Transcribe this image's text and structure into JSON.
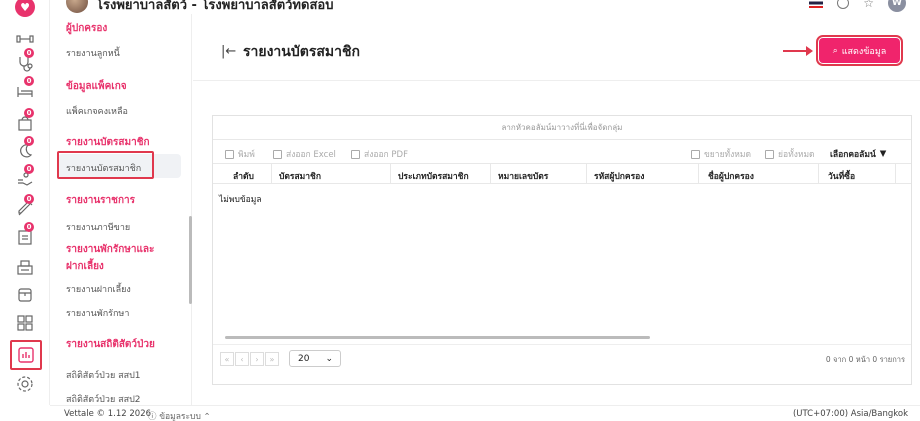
{
  "header": {
    "title": "โรงพยาบาลสัตว์ - โรงพยาบาลสัตว์ทดสอบ",
    "user_initial": "W"
  },
  "submenu": {
    "items": [
      {
        "type": "heading",
        "label": "ผู้ปกครอง"
      },
      {
        "type": "link",
        "label": "รายงานลูกหนี้"
      },
      {
        "type": "heading",
        "label": "ข้อมูลแพ็คเกจ"
      },
      {
        "type": "link",
        "label": "แพ็คเกจคงเหลือ"
      },
      {
        "type": "heading",
        "label": "รายงานบัตรสมาชิก"
      },
      {
        "type": "link",
        "label": "รายงานบัตรสมาชิก",
        "active": true
      },
      {
        "type": "heading",
        "label": "รายงานราชการ"
      },
      {
        "type": "link",
        "label": "รายงานภาษีขาย"
      },
      {
        "type": "heading",
        "label": "รายงานพักรักษาและ"
      },
      {
        "type": "heading",
        "label": "ฝากเลี้ยง"
      },
      {
        "type": "link",
        "label": "รายงานฝากเลี้ยง"
      },
      {
        "type": "link",
        "label": "รายงานพักรักษา"
      },
      {
        "type": "heading",
        "label": "รายงานสถิติสัตว์ป่วย"
      },
      {
        "type": "link",
        "label": "สถิติสัตว์ป่วย สสป1"
      },
      {
        "type": "link",
        "label": "สถิติสัตว์ป่วย สสป2"
      }
    ]
  },
  "rail": {
    "badges": [
      "0",
      "0",
      "0",
      "0",
      "0",
      "0",
      "0"
    ]
  },
  "main": {
    "title": "รายงานบัตรสมาชิก",
    "show_button": "แสดงข้อมูล",
    "grid": {
      "group_panel": "ลากหัวคอลัมน์มาวางที่นี่เพื่อจัดกลุ่ม",
      "toolbar": {
        "print": "พิมพ์",
        "export_excel": "ส่งออก Excel",
        "export_pdf": "ส่งออก PDF",
        "expand_all": "ขยายทั้งหมด",
        "collapse_all": "ย่อทั้งหมด",
        "choose_columns": "เลือกคอลัมน์"
      },
      "columns": [
        "ลำดับ",
        "บัตรสมาชิก",
        "ประเภทบัตรสมาชิก",
        "หมายเลขบัตร",
        "รหัสผู้ปกครอง",
        "ชื่อผู้ปกครอง",
        "วันที่ซื้อ"
      ],
      "no_data": "ไม่พบข้อมูล",
      "pager": {
        "page_size": "20",
        "info": "0 จาก 0 หน้า 0 รายการ"
      }
    }
  },
  "footer": {
    "version": "Vettale © 1.12 2026",
    "system_info": "ข้อมูลระบบ",
    "timezone": "(UTC+07:00) Asia/Bangkok"
  }
}
